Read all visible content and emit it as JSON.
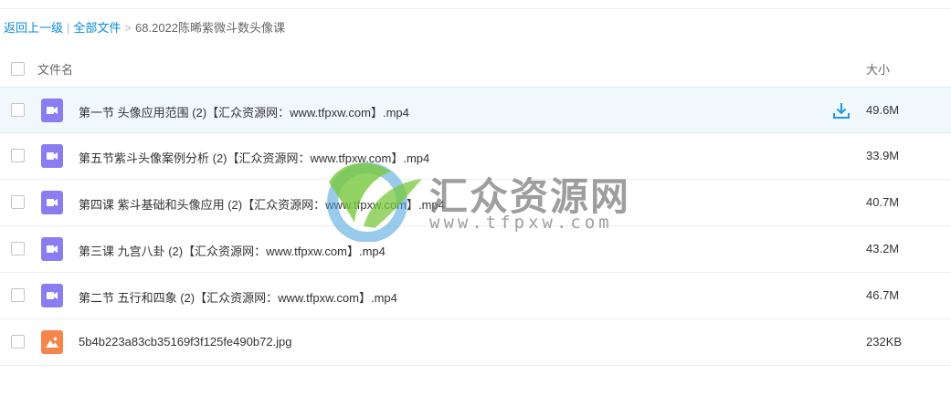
{
  "breadcrumb": {
    "back": "返回上一级",
    "separator": "|",
    "all_files": "全部文件",
    "arrow": ">",
    "current": "68.2022陈晞紫微斗数头像课"
  },
  "header": {
    "name_col": "文件名",
    "size_col": "大小"
  },
  "files": [
    {
      "name": "第一节 头像应用范围 (2)【汇众资源网：www.tfpxw.com】.mp4",
      "size": "49.6M",
      "icon": "video-file-icon"
    },
    {
      "name": "第五节紫斗头像案例分析 (2)【汇众资源网：www.tfpxw.com】.mp4",
      "size": "33.9M",
      "icon": "video-file-icon"
    },
    {
      "name": "第四课 紫斗基础和头像应用 (2)【汇众资源网：www.tfpxw.com】.mp4",
      "size": "40.7M",
      "icon": "video-file-icon"
    },
    {
      "name": "第三课 九宫八卦 (2)【汇众资源网：www.tfpxw.com】.mp4",
      "size": "43.2M",
      "icon": "video-file-icon"
    },
    {
      "name": "第二节 五行和四象 (2)【汇众资源网：www.tfpxw.com】.mp4",
      "size": "46.7M",
      "icon": "video-file-icon"
    },
    {
      "name": "5b4b223a83cb35169f3f125fe490b72.jpg",
      "size": "232KB",
      "icon": "image-file-icon"
    }
  ],
  "watermark": {
    "title": "汇众资源网",
    "url": "www.tfpxw.com"
  },
  "colors": {
    "link": "#0a8ad8",
    "video_icon": "#8a7df2",
    "image_icon": "#f7854a",
    "row_hover": "#f1f8fc",
    "download_icon": "#1c9be2"
  }
}
